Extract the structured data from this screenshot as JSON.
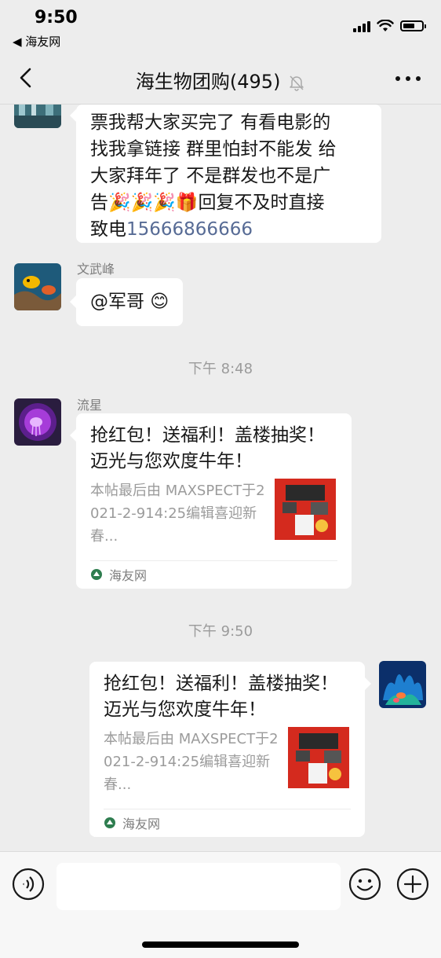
{
  "status": {
    "time": "9:50",
    "back_app": "◀ 海友网",
    "battery_fraction": 0.65
  },
  "nav": {
    "title": "海生物团购(495)"
  },
  "messages": {
    "m1": {
      "lines": [
        "票我帮大家买完了 有看电影的",
        "找我拿链接 群里怕封不能发 给",
        "大家拜年了 不是群发也不是广",
        "告🎉🎉🎉🎁回复不及时直接"
      ],
      "last_prefix": "致电",
      "phone": "15666866666"
    },
    "m2": {
      "sender": "文武峰",
      "text": "@军哥 😊"
    },
    "ts1": "下午 8:48",
    "m3": {
      "sender": "流星",
      "card_title": "抢红包！送福利！盖楼抽奖！迈光与您欢度牛年！",
      "card_desc": "本帖最后由 MAXSPECT于2021-2-914:25编辑喜迎新春...",
      "source": "海友网"
    },
    "ts2": "下午 9:50",
    "m4": {
      "card_title": "抢红包！送福利！盖楼抽奖！迈光与您欢度牛年！",
      "card_desc": "本帖最后由 MAXSPECT于2021-2-914:25编辑喜迎新春...",
      "source": "海友网"
    }
  },
  "input": {
    "placeholder": ""
  },
  "colors": {
    "background": "#ededed",
    "bubble": "#ffffff",
    "link": "#576b95",
    "meta": "#9b9b9b"
  }
}
